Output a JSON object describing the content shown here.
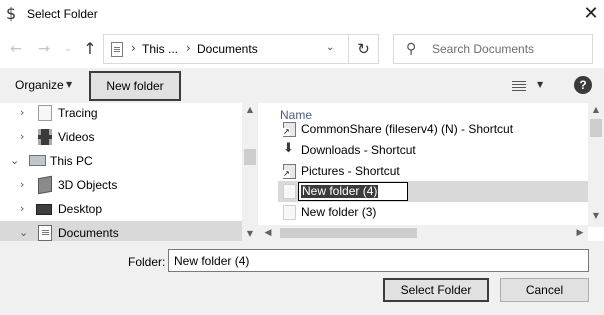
{
  "window": {
    "title": "Select Folder",
    "app_icon": "dollar-sign-icon",
    "close_glyph": "✕"
  },
  "nav": {
    "back_glyph": "←",
    "forward_glyph": "→",
    "recent_glyph": "⌄",
    "up_glyph": "↑",
    "address": {
      "crumbs": [
        "This ...",
        "Documents"
      ],
      "separator": "›"
    },
    "refresh_glyph": "↻",
    "search": {
      "placeholder": "Search Documents",
      "value": ""
    }
  },
  "toolbar": {
    "organize_label": "Organize",
    "new_folder_label": "New folder",
    "help_label": "?"
  },
  "nav_pane": {
    "items": [
      {
        "label": "Tracing",
        "icon": "document-icon",
        "expandable": true
      },
      {
        "label": "Videos",
        "icon": "videos-icon",
        "expandable": true
      },
      {
        "label": "This PC",
        "icon": "computer-icon",
        "expandable": true,
        "expanded": true
      },
      {
        "label": "3D Objects",
        "icon": "cube-icon",
        "expandable": true
      },
      {
        "label": "Desktop",
        "icon": "desktop-icon",
        "expandable": true
      },
      {
        "label": "Documents",
        "icon": "documents-icon",
        "expandable": true,
        "selected": true
      }
    ]
  },
  "file_list": {
    "column_header": "Name",
    "items": [
      {
        "label": "CommonShare (fileserv4) (N) - Shortcut",
        "icon": "shortcut-icon"
      },
      {
        "label": "Downloads - Shortcut",
        "icon": "downloads-icon"
      },
      {
        "label": "Pictures - Shortcut",
        "icon": "shortcut-icon"
      },
      {
        "label": "New folder (4)",
        "icon": "folder-icon",
        "renaming": true
      },
      {
        "label": "New folder (3)",
        "icon": "folder-icon"
      }
    ]
  },
  "footer": {
    "folder_label": "Folder:",
    "folder_value": "New folder (4)",
    "select_button": "Select Folder",
    "cancel_button": "Cancel"
  }
}
